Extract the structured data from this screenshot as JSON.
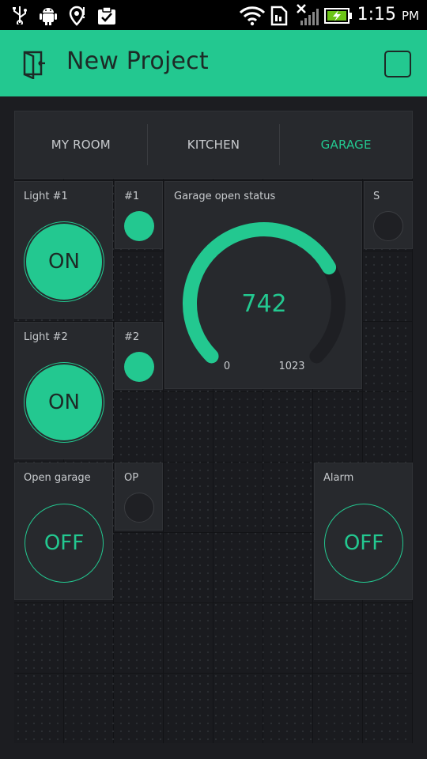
{
  "status_bar": {
    "time": "1:15",
    "ampm": "PM",
    "icons": [
      "usb-icon",
      "android-debug-icon",
      "location-icon",
      "clipboard-check-icon",
      "wifi-icon",
      "sim-icon",
      "no-signal-icon",
      "battery-charging-icon"
    ]
  },
  "app_bar": {
    "title": "New Project",
    "back_icon": "exit-project-icon",
    "action_icon": "square-icon"
  },
  "tabs": [
    {
      "label": "MY ROOM",
      "active": false
    },
    {
      "label": "KITCHEN",
      "active": false
    },
    {
      "label": "GARAGE",
      "active": true
    }
  ],
  "widgets": {
    "light1": {
      "label": "Light #1",
      "state": "ON"
    },
    "light2": {
      "label": "Light #2",
      "state": "ON"
    },
    "open_garage": {
      "label": "Open garage",
      "state": "OFF"
    },
    "alarm": {
      "label": "Alarm",
      "state": "OFF"
    },
    "led1": {
      "label": "#1",
      "on": true
    },
    "led2": {
      "label": "#2",
      "on": true
    },
    "led_op": {
      "label": "OP",
      "on": false
    },
    "led_s": {
      "label": "S",
      "on": false
    },
    "gauge": {
      "label": "Garage open status",
      "value": "742",
      "min": "0",
      "max": "1023",
      "value_num": 742,
      "max_num": 1023
    }
  },
  "colors": {
    "accent": "#23c890",
    "background": "#1c1d21",
    "widget": "#27292d"
  }
}
